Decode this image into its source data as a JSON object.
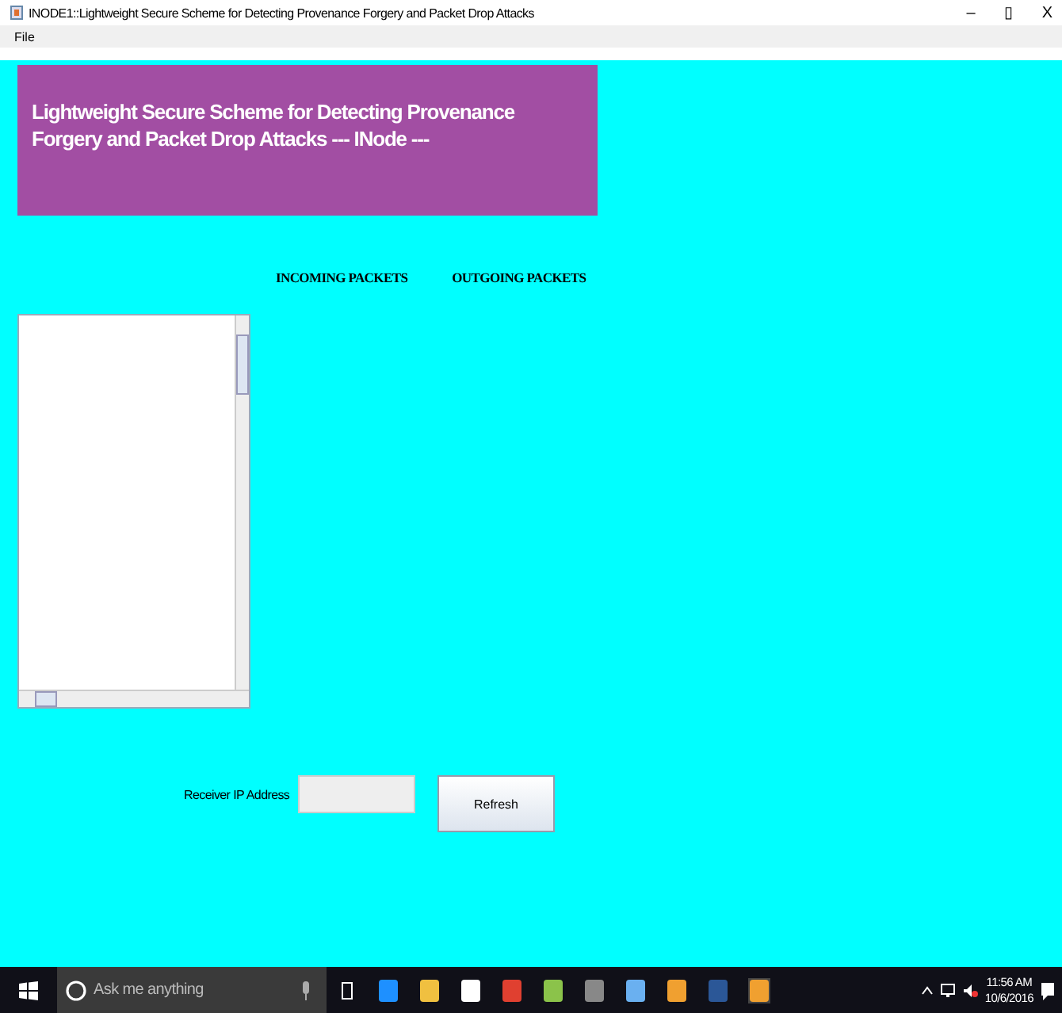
{
  "window": {
    "title": "INODE1::Lightweight Secure Scheme for Detecting Provenance Forgery and Packet Drop Attacks",
    "controls": [
      "–",
      "▯",
      "X"
    ]
  },
  "menu": [
    "File"
  ],
  "banner": {
    "title": "Lightweight Secure Scheme for Detecting Provenance Forgery and Packet Drop Attacks --- INode ---"
  },
  "headings": [
    "INCOMING PACKETS",
    "OUTGOING PACKETS"
  ],
  "receiver": {
    "label": "Receiver IP Address",
    "button": "Refresh"
  },
  "taskbar": {
    "search_placeholder": "Ask me anything",
    "time": "11:56 AM",
    "date": "10/6/2016"
  }
}
